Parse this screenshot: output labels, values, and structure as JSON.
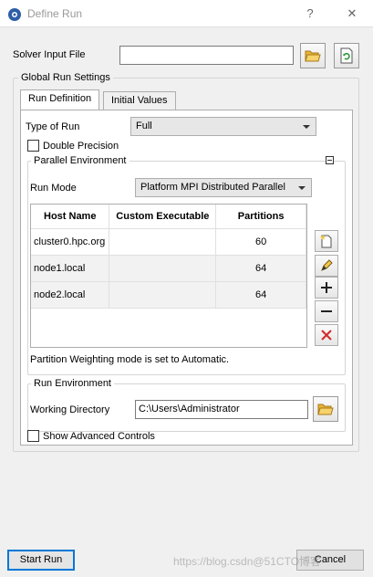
{
  "window": {
    "title": "Define Run",
    "help": "?",
    "close": "✕"
  },
  "solver": {
    "label": "Solver Input File",
    "value": ""
  },
  "global": {
    "title": "Global Run Settings",
    "tabs": [
      "Run Definition",
      "Initial Values"
    ],
    "type_of_run_label": "Type of Run",
    "type_of_run_value": "Full",
    "double_precision_label": "Double Precision"
  },
  "parallel": {
    "title": "Parallel Environment",
    "run_mode_label": "Run Mode",
    "run_mode_value": "Platform MPI Distributed Parallel",
    "columns": [
      "Host Name",
      "Custom Executable",
      "Partitions"
    ],
    "rows": [
      {
        "host": "cluster0.hpc.org",
        "exe": "",
        "partitions": "60"
      },
      {
        "host": "node1.local",
        "exe": "",
        "partitions": "64"
      },
      {
        "host": "node2.local",
        "exe": "",
        "partitions": "64"
      }
    ],
    "weighting_note": "Partition Weighting mode is set to Automatic."
  },
  "run_env": {
    "title": "Run Environment",
    "working_dir_label": "Working Directory",
    "working_dir_value": "C:\\Users\\Administrator"
  },
  "advanced": {
    "label": "Show Advanced Controls"
  },
  "footer": {
    "start": "Start Run",
    "cancel": "Cancel",
    "watermark": "https://blog.csdn@51CTO博客"
  },
  "colors": {
    "accent": "#0078d7",
    "folder": "#f2c94c",
    "delete": "#d32f2f"
  }
}
